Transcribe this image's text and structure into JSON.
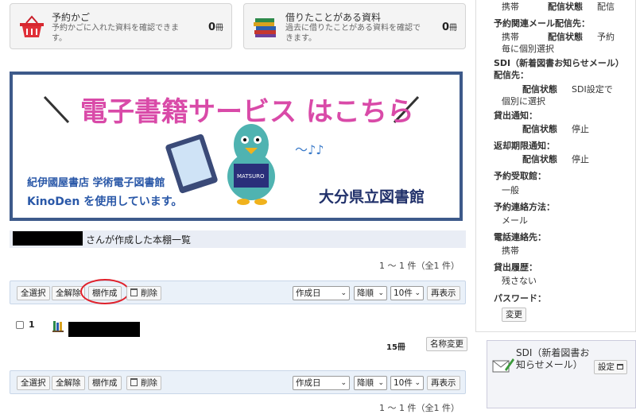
{
  "cards": [
    {
      "title": "予約かご",
      "desc": "予約かごに入れた資料を確認できます。",
      "count": "0",
      "unit": "冊"
    },
    {
      "title": "借りたことがある資料",
      "desc": "過去に借りたことがある資料を確認できます。",
      "count": "0",
      "unit": "冊"
    }
  ],
  "banner": {
    "title": "電子書籍サービス はこちら",
    "left1": "紀伊國屋書店 学術電子図書館",
    "left2": "KinoDen を使用しています。",
    "right": "大分県立図書館",
    "mascot_shirt": "MATSURO"
  },
  "owner_text": "さんが作成した本棚一覧",
  "range": "1 ～ 1 件（全1 件）",
  "toolbar": {
    "select_all": "全選択",
    "deselect_all": "全解除",
    "create": "棚作成",
    "delete": "削除",
    "sort_field": "作成日",
    "sort_order": "降順",
    "per_page": "10件",
    "redisplay": "再表示"
  },
  "shelf": {
    "index": "1",
    "count": "15冊",
    "rename": "名称変更"
  },
  "right_panel": {
    "top_row": {
      "value": "携帯",
      "label": "配信状態",
      "state": "配信"
    },
    "reserve_mail": {
      "heading": "予約関連メール配信先：",
      "value": "携帯",
      "label": "配信状態",
      "state": "予約毎に個別選択"
    },
    "sdi_dest": {
      "heading": "SDI（新着図書お知らせメール）配信先：",
      "label": "配信状態",
      "state": "SDI設定で個別に選択"
    },
    "loan_notice": {
      "heading": "貸出通知：",
      "label": "配信状態",
      "state": "停止"
    },
    "due_notice": {
      "heading": "返却期限通知：",
      "label": "配信状態",
      "state": "停止"
    },
    "pickup": {
      "heading": "予約受取館：",
      "value": "一般"
    },
    "contact_method": {
      "heading": "予約連絡方法：",
      "value": "メール"
    },
    "phone": {
      "heading": "電話連絡先：",
      "value": "携帯"
    },
    "history": {
      "heading": "貸出履歴：",
      "value": "残さない"
    },
    "password": {
      "heading": "パスワード：",
      "change": "変更"
    }
  },
  "sdi_box": {
    "title": "SDI（新着図書お知らせメール）",
    "settings": "設定"
  },
  "colors": {
    "toolbar_bg": "#eaf1f9",
    "highlight": "#e0202a",
    "banner_border": "#3d5a8a"
  }
}
